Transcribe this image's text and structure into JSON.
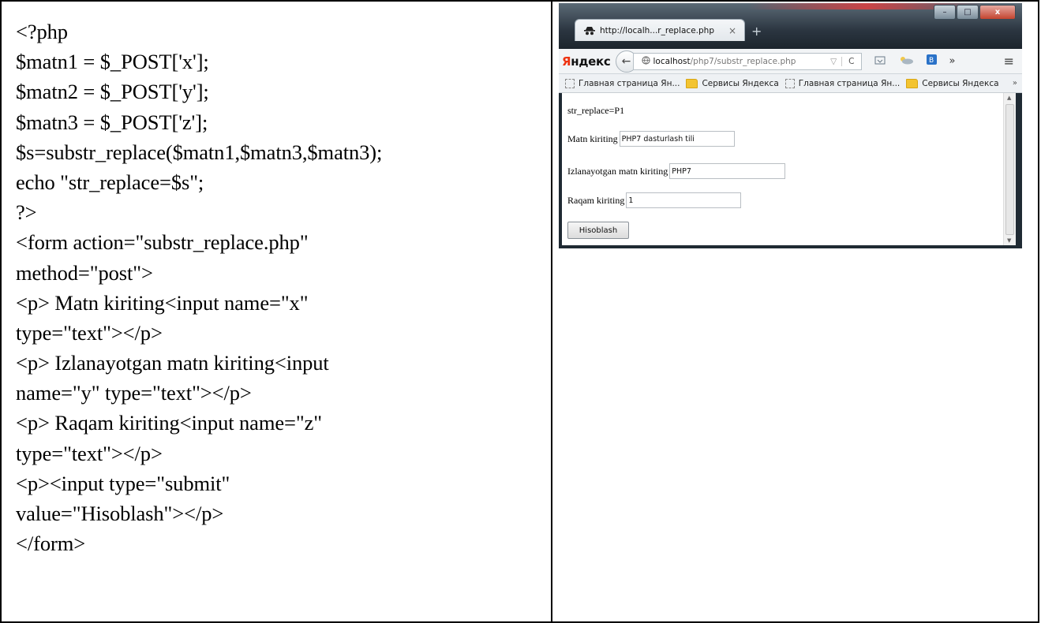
{
  "code_lines": [
    "<?php",
    "$matn1 = $_POST['x'];",
    "$matn2 = $_POST['y'];",
    "$matn3 = $_POST['z'];",
    "$s=substr_replace($matn1,$matn3,$matn3);",
    "echo \"str_replace=$s\";",
    "?>",
    "<form action=\"substr_replace.php\"",
    "method=\"post\">",
    "<p> Matn kiriting<input name=\"x\"",
    "type=\"text\"></p>",
    "<p> Izlanayotgan matn kiriting<input",
    "name=\"y\" type=\"text\"></p>",
    "<p> Raqam kiriting<input name=\"z\"",
    "type=\"text\"></p>",
    "<p><input type=\"submit\"",
    "value=\"Hisoblash\"></p>",
    "</form>"
  ],
  "browser": {
    "tab_title": "http://localh...r_replace.php",
    "tab_close": "×",
    "new_tab": "+",
    "window_controls": {
      "minimize": "–",
      "maximize": "□",
      "close": "x"
    },
    "brand": {
      "first": "Я",
      "rest": "ндекс"
    },
    "back": "←",
    "url": {
      "host": "localhost",
      "path": "/php7/substr_replace.php",
      "dropdown": "▽",
      "reload": "C"
    },
    "more": "»",
    "menu": "≡",
    "bookmarks": [
      {
        "label": "Главная страница Ян...",
        "icon": "page"
      },
      {
        "label": "Сервисы Яндекса",
        "icon": "folder"
      },
      {
        "label": "Главная страница Ян...",
        "icon": "page"
      },
      {
        "label": "Сервисы Яндекса",
        "icon": "folder"
      }
    ],
    "bookmarks_more": "»",
    "page": {
      "result": "str_replace=P1",
      "fields": [
        {
          "label": "Matn kiriting",
          "value": "PHP7 dasturlash tili"
        },
        {
          "label": "Izlanayotgan matn kiriting",
          "value": "PHP7"
        },
        {
          "label": "Raqam kiriting",
          "value": "1"
        }
      ],
      "submit": "Hisoblash"
    }
  }
}
